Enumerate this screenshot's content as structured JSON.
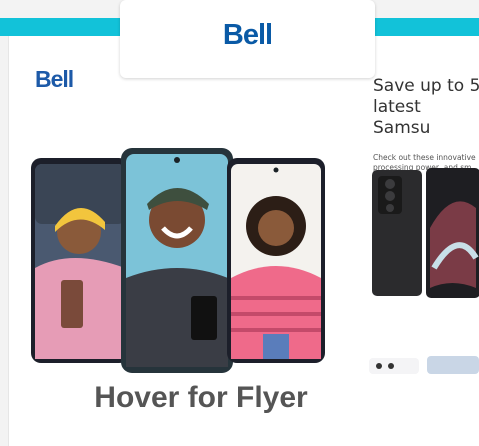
{
  "tab": {
    "logo_text": "Bell"
  },
  "flyer": {
    "logo_text": "Bell",
    "headline": "Save up to 5\nlatest Samsu",
    "description": "Check out these innovative\nprocessing power, and sm"
  },
  "hover_label": "Hover for Flyer",
  "colors": {
    "accent_stripe": "#12c2d9",
    "brand_blue": "#0a5aa6"
  }
}
